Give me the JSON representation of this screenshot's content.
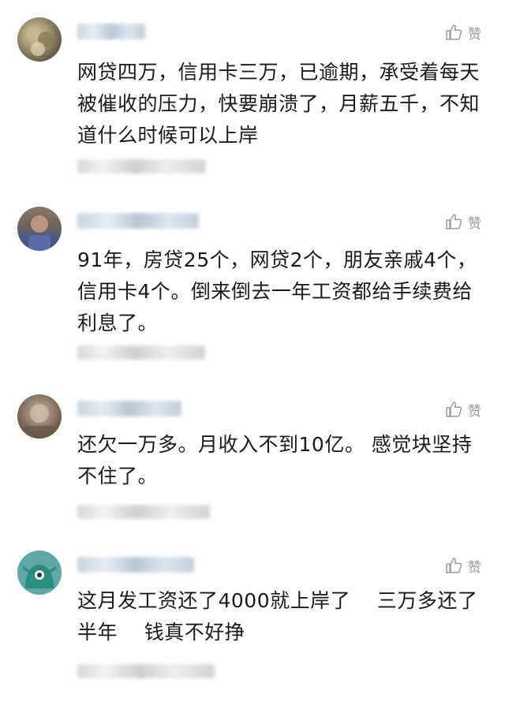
{
  "like_label": "赞",
  "comments": [
    {
      "avatar": "avatar-1",
      "content": "网贷四万，信用卡三万，已逾期，承受着每天被催收的压力，快要崩溃了，月薪五千，不知道什么时候可以上岸"
    },
    {
      "avatar": "avatar-2",
      "content": "91年，房贷25个，网贷2个，朋友亲戚4个，信用卡4个。倒来倒去一年工资都给手续费给利息了。"
    },
    {
      "avatar": "avatar-3",
      "content": "还欠一万多。月收入不到10亿。 感觉块坚持不住了。"
    },
    {
      "avatar": "avatar-4",
      "content": "这月发工资还了4000就上岸了    三万多还了半年    钱真不好挣"
    }
  ]
}
